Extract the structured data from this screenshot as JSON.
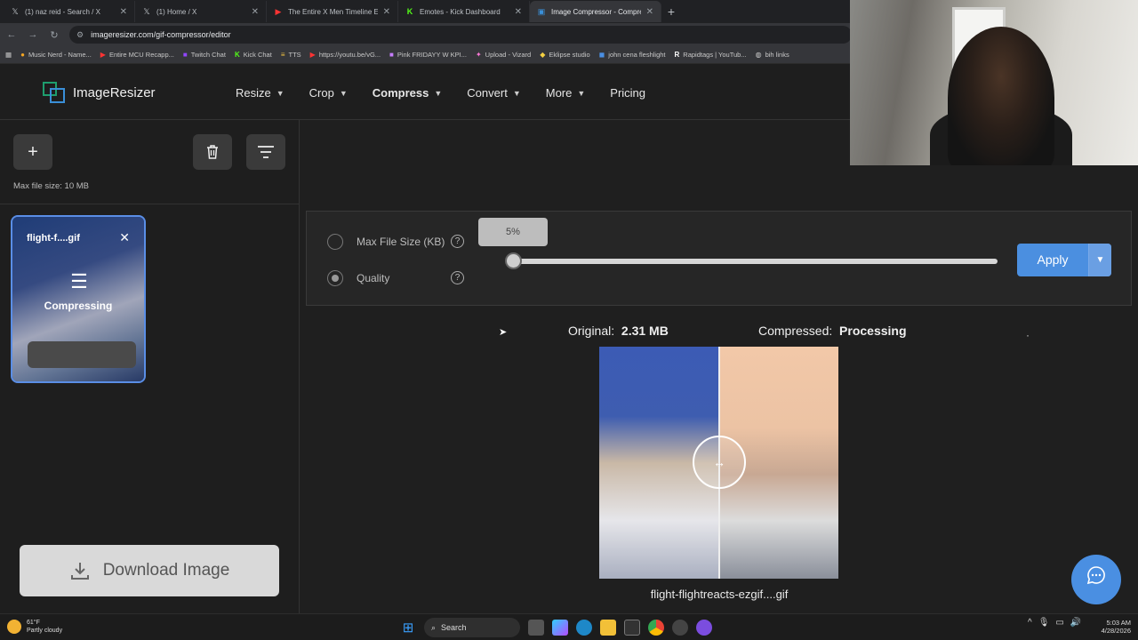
{
  "browser": {
    "tabs": [
      {
        "icon": "x-icon",
        "title": "(1) naz reid - Search / X",
        "active": false
      },
      {
        "icon": "x-icon",
        "title": "(1) Home / X",
        "active": false
      },
      {
        "icon": "youtube-icon",
        "title": "The Entire X Men Timeline Expl",
        "active": false
      },
      {
        "icon": "kick-icon",
        "title": "Emotes - Kick Dashboard",
        "active": false
      },
      {
        "icon": "image-icon",
        "title": "Image Compressor - Compress",
        "active": true
      }
    ],
    "url": "imageresizer.com/gif-compressor/editor",
    "bookmarks": [
      "Music Nerd - Name...",
      "Entire MCU Recapp...",
      "Twitch Chat",
      "Kick Chat",
      "TTS",
      "https://youtu.be/vG...",
      "Pink FRIDAYY W KPI...",
      "Upload - Vizard",
      "Eklipse studio",
      "john cena fleshlight",
      "Rapidtags | YouTub...",
      "bih links"
    ]
  },
  "app": {
    "logo_text": "ImageResizer",
    "nav": [
      {
        "label": "Resize",
        "has_menu": true
      },
      {
        "label": "Crop",
        "has_menu": true
      },
      {
        "label": "Compress",
        "has_menu": true
      },
      {
        "label": "Convert",
        "has_menu": true
      },
      {
        "label": "More",
        "has_menu": true
      },
      {
        "label": "Pricing",
        "has_menu": false
      }
    ]
  },
  "left_panel": {
    "add_icon": "plus-icon",
    "delete_icon": "trash-icon",
    "filter_icon": "filter-icon",
    "max_file_size": "Max file size: 10 MB",
    "thumbnail": {
      "name": "flight-f....gif",
      "status": "Compressing",
      "status_icon": "compress-icon"
    },
    "download_label": "Download Image"
  },
  "settings": {
    "option_max": "Max File Size (KB)",
    "option_quality": "Quality",
    "selected": "Quality",
    "slider_label": "5%",
    "slider_value": 0.05,
    "apply_label": "Apply"
  },
  "compare": {
    "original_label": "Original:",
    "original_value": "2.31 MB",
    "compressed_label": "Compressed:",
    "compressed_value": "Processing",
    "filename": "flight-flightreacts-ezgif....gif",
    "handle_icon": "left-right-arrows-icon"
  },
  "taskbar": {
    "weather_temp": "61°F",
    "weather_desc": "Partly cloudy",
    "search_label": "Search",
    "time": "5:03 AM",
    "date": "4/28/2026"
  },
  "colors": {
    "accent": "#4b8fe0",
    "background": "#1f1f1f",
    "logo_green": "#1e9e6e",
    "logo_blue": "#3a8fd8"
  }
}
